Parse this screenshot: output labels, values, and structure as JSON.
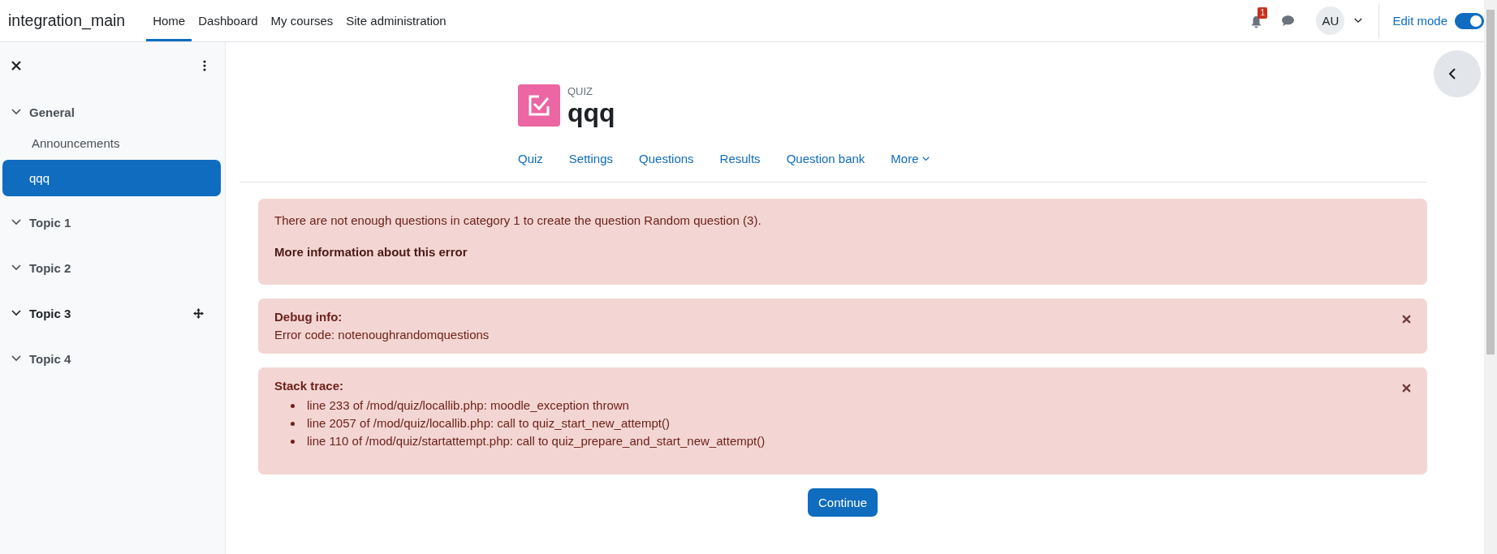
{
  "navbar": {
    "site_name": "integration_main",
    "links": [
      {
        "label": "Home",
        "selected": true
      },
      {
        "label": "Dashboard",
        "selected": false
      },
      {
        "label": "My courses",
        "selected": false
      },
      {
        "label": "Site administration",
        "selected": false
      }
    ],
    "notification_count": "1",
    "user_initials": "AU",
    "edit_mode": {
      "label": "Edit mode",
      "on": true
    }
  },
  "course_index": {
    "items": [
      {
        "kind": "section",
        "label": "General",
        "expanded": true,
        "hovered": false,
        "children": [
          {
            "kind": "activity",
            "label": "Announcements",
            "selected": false
          },
          {
            "kind": "activity",
            "label": "qqq",
            "selected": true
          }
        ]
      },
      {
        "kind": "section",
        "label": "Topic 1",
        "expanded": true,
        "hovered": false
      },
      {
        "kind": "section",
        "label": "Topic 2",
        "expanded": true,
        "hovered": false
      },
      {
        "kind": "section",
        "label": "Topic 3",
        "expanded": true,
        "hovered": true
      },
      {
        "kind": "section",
        "label": "Topic 4",
        "expanded": true,
        "hovered": false
      }
    ]
  },
  "activity_header": {
    "type_label": "QUIZ",
    "title": "qqq"
  },
  "secondary_nav": [
    {
      "label": "Quiz",
      "dropdown": false
    },
    {
      "label": "Settings",
      "dropdown": false
    },
    {
      "label": "Questions",
      "dropdown": false
    },
    {
      "label": "Results",
      "dropdown": false
    },
    {
      "label": "Question bank",
      "dropdown": false
    },
    {
      "label": "More",
      "dropdown": true
    }
  ],
  "alerts": [
    {
      "kind": "message",
      "text": "There are not enough questions in category 1 to create the question Random question (3).",
      "link": "More information about this error",
      "closable": false
    },
    {
      "kind": "debug",
      "heading": "Debug info:",
      "text": "Error code: notenoughrandomquestions",
      "closable": true
    },
    {
      "kind": "trace",
      "heading": "Stack trace:",
      "lines": [
        "line 233 of /mod/quiz/locallib.php: moodle_exception thrown",
        "line 2057 of /mod/quiz/locallib.php: call to quiz_start_new_attempt()",
        "line 110 of /mod/quiz/startattempt.php: call to quiz_prepare_and_start_new_attempt()"
      ],
      "closable": true
    }
  ],
  "continue_button": "Continue"
}
